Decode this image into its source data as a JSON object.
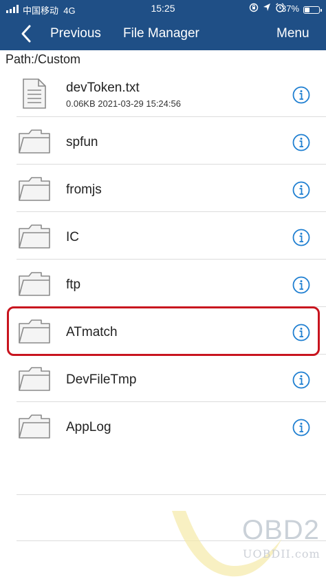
{
  "status_bar": {
    "carrier": "中国移动",
    "network": "4G",
    "time": "15:25",
    "battery_percent": "37%",
    "battery_level": 0.37,
    "icons": [
      "rotation-lock-icon",
      "location-icon",
      "alarm-icon"
    ]
  },
  "nav": {
    "back_icon": "chevron-left-icon",
    "previous_label": "Previous",
    "title": "File Manager",
    "menu_label": "Menu"
  },
  "path_label": "Path:/Custom",
  "items": [
    {
      "name": "devToken.txt",
      "meta": "0.06KB 2021-03-29 15:24:56",
      "icon": "document-icon"
    },
    {
      "name": "spfun",
      "icon": "folder-icon"
    },
    {
      "name": "fromjs",
      "icon": "folder-icon"
    },
    {
      "name": "IC",
      "icon": "folder-icon"
    },
    {
      "name": "ftp",
      "icon": "folder-icon"
    },
    {
      "name": "ATmatch",
      "icon": "folder-icon"
    },
    {
      "name": "DevFileTmp",
      "icon": "folder-icon"
    },
    {
      "name": "AppLog",
      "icon": "folder-icon"
    }
  ],
  "watermark": {
    "text": "OBD2",
    "sub": "UOBDII.com"
  },
  "colors": {
    "header": "#1f4f86",
    "info_icon": "#1f7fd1",
    "highlight": "#c8141e"
  }
}
